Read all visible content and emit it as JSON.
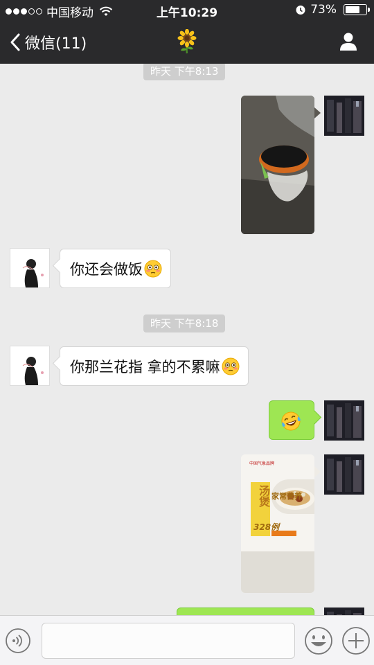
{
  "status_bar": {
    "carrier": "中国移动",
    "time": "上午10:29",
    "battery_percent": "73%",
    "battery_level": 0.73,
    "signal_bars": 3,
    "icons": [
      "signal-dots-icon",
      "wifi-icon",
      "alarm-icon",
      "battery-icon"
    ]
  },
  "nav": {
    "back_label": "微信(11)",
    "title_icon": "sunflower-icon",
    "right_icon": "profile-icon"
  },
  "messages": {
    "ts1": "昨天 下午8:13",
    "m1": {
      "from": "me",
      "type": "image"
    },
    "m2": {
      "from": "other",
      "text": "你还会做饭",
      "emoji": "flushed-face-emoji"
    },
    "ts2": "昨天 下午8:18",
    "m3": {
      "from": "other",
      "text": "你那兰花指 拿的不累嘛",
      "emoji": "flushed-face-emoji"
    },
    "m4": {
      "from": "me",
      "type": "emoji",
      "emoji": "laughing-crying-face-emoji"
    },
    "m5": {
      "from": "me",
      "type": "image",
      "image_text": {
        "brand": "中国气象品牌",
        "title_big": "汤煲",
        "title_side": "家常营养",
        "count": "328例"
      }
    },
    "m6": {
      "from": "me",
      "type": "text-partial"
    }
  },
  "input_bar": {
    "placeholder": "",
    "icons": [
      "voice-icon",
      "emoji-icon",
      "plus-icon"
    ]
  },
  "colors": {
    "bar_bg": "#2a2a2c",
    "chat_bg": "#ebebeb",
    "out_bubble": "#9ee653",
    "timestamp_bg": "#cecece"
  }
}
